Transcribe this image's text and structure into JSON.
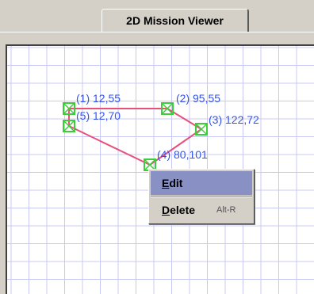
{
  "tab": {
    "title": "2D Mission Viewer"
  },
  "viewer": {
    "waypoints": [
      {
        "label": "(1) 12,55"
      },
      {
        "label": "(2) 95,55"
      },
      {
        "label": "(3) 122,72"
      },
      {
        "label": "(4) 80,101"
      },
      {
        "label": "(5) 12,70"
      }
    ],
    "colors": {
      "path": "#e8507a",
      "marker": "#3ccc3c",
      "label": "#3355ee",
      "grid": "#c8c8f4"
    }
  },
  "context_menu": {
    "items": [
      {
        "accel_char": "E",
        "rest": "dit",
        "accel": ""
      },
      {
        "accel_char": "D",
        "rest": "elete",
        "accel": "Alt-R"
      }
    ]
  }
}
